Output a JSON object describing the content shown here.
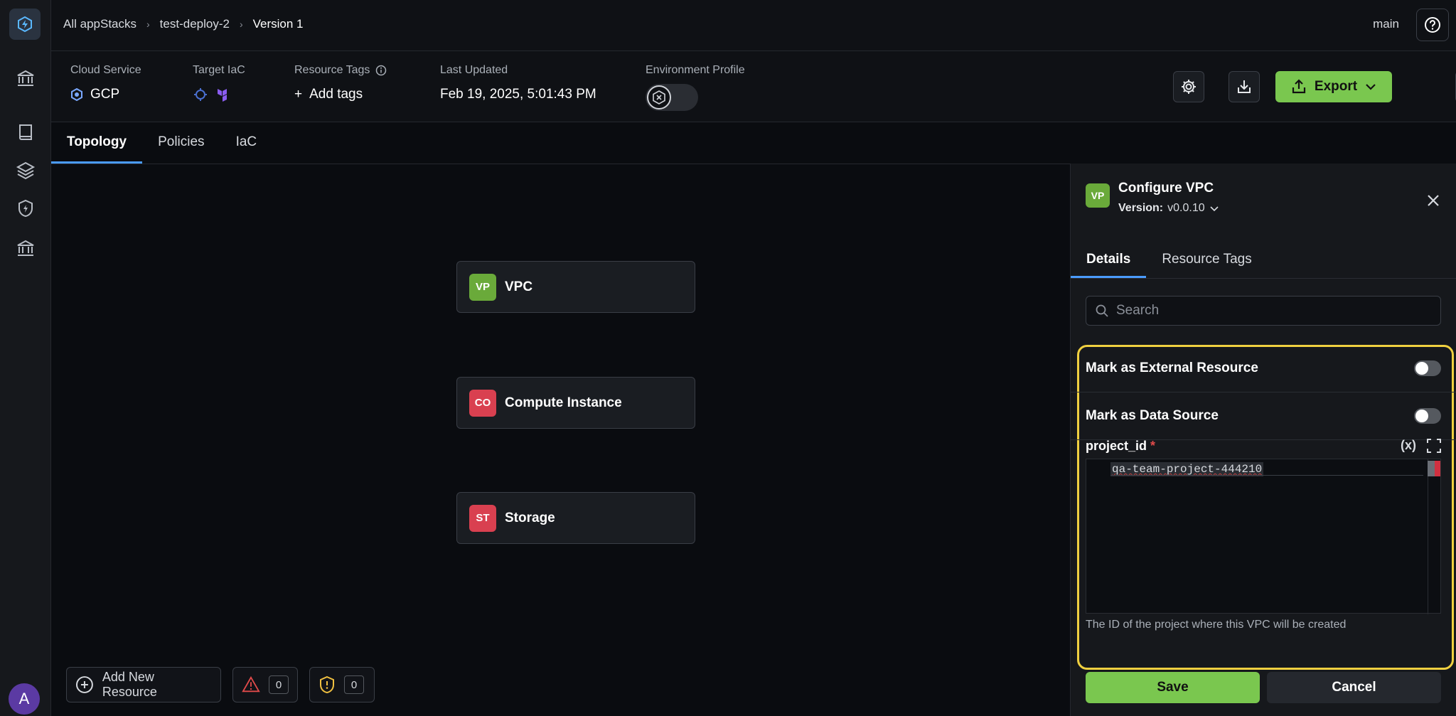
{
  "breadcrumb": {
    "root": "All appStacks",
    "project": "test-deploy-2",
    "version": "Version 1"
  },
  "branch": "main",
  "meta": {
    "cloud_service_label": "Cloud Service",
    "cloud_service_value": "GCP",
    "target_iac_label": "Target IaC",
    "resource_tags_label": "Resource Tags",
    "add_tags": "Add tags",
    "last_updated_label": "Last Updated",
    "last_updated_value": "Feb 19, 2025, 5:01:43 PM",
    "env_profile_label": "Environment Profile"
  },
  "export_label": "Export",
  "tabs": [
    "Topology",
    "Policies",
    "IaC"
  ],
  "nodes": [
    {
      "badge": "VP",
      "label": "VPC"
    },
    {
      "badge": "CO",
      "label": "Compute Instance"
    },
    {
      "badge": "ST",
      "label": "Storage"
    }
  ],
  "bottom": {
    "add_resource": "Add New Resource",
    "warnings": "0",
    "policies": "0"
  },
  "panel": {
    "badge": "VP",
    "title": "Configure VPC",
    "version_label": "Version:",
    "version_value": "v0.0.10",
    "tabs": [
      "Details",
      "Resource Tags"
    ],
    "search_placeholder": "Search",
    "external_label": "Mark as External Resource",
    "datasource_label": "Mark as Data Source",
    "field_name": "project_id",
    "field_required": "*",
    "field_var_icon": "(x)",
    "field_value": "qa-team-project-444210",
    "field_hint": "The ID of the project where this VPC will be created",
    "save": "Save",
    "cancel": "Cancel"
  },
  "user_initial": "A",
  "colors": {
    "accent": "#7ac74f",
    "tab_underline": "#4a9bff",
    "highlight": "#f0d040",
    "danger": "#d94050"
  }
}
